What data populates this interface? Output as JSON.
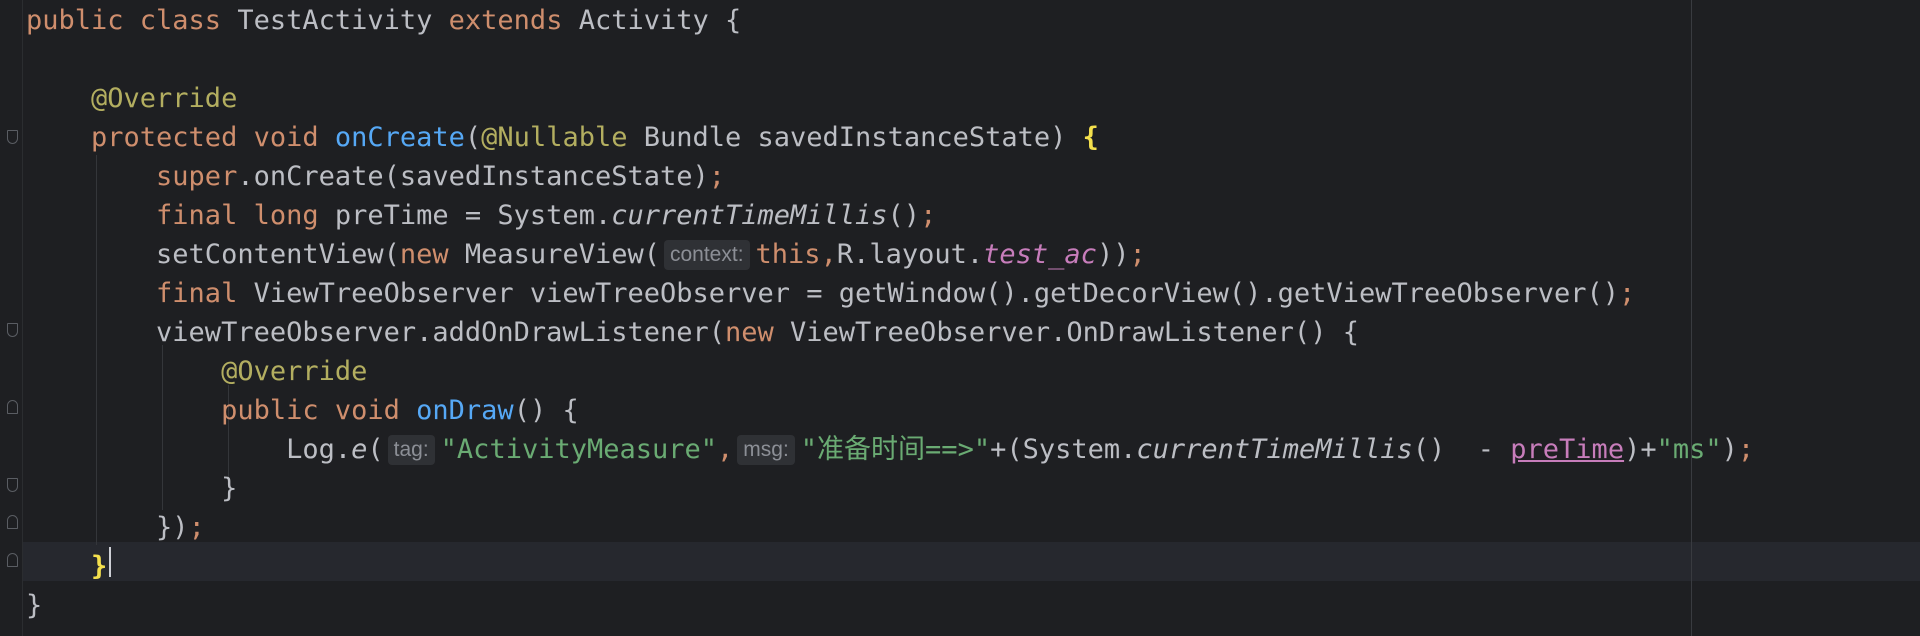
{
  "editor": {
    "lines": [
      {
        "tokens": [
          {
            "t": "public class ",
            "c": "kw"
          },
          {
            "t": "TestActivity ",
            "c": "plain"
          },
          {
            "t": "extends ",
            "c": "kw"
          },
          {
            "t": "Activity {",
            "c": "plain"
          }
        ]
      },
      {
        "tokens": []
      },
      {
        "tokens": [
          {
            "t": "    @Override",
            "c": "ann"
          }
        ]
      },
      {
        "tokens": [
          {
            "t": "    protected void ",
            "c": "kw"
          },
          {
            "t": "onCreate",
            "c": "fn"
          },
          {
            "t": "(",
            "c": "plain"
          },
          {
            "t": "@Nullable ",
            "c": "ann"
          },
          {
            "t": "Bundle savedInstanceState) ",
            "c": "plain"
          },
          {
            "t": "{",
            "c": "brace-hl"
          }
        ]
      },
      {
        "tokens": [
          {
            "t": "        super",
            "c": "kw"
          },
          {
            "t": ".onCreate(savedInstanceState)",
            "c": "plain"
          },
          {
            "t": ";",
            "c": "kw"
          }
        ]
      },
      {
        "tokens": [
          {
            "t": "        final long ",
            "c": "kw"
          },
          {
            "t": "preTime = System.",
            "c": "plain"
          },
          {
            "t": "currentTimeMillis",
            "c": "italic"
          },
          {
            "t": "()",
            "c": "plain"
          },
          {
            "t": ";",
            "c": "kw"
          }
        ]
      },
      {
        "tokens": [
          {
            "t": "        setContentView(",
            "c": "plain"
          },
          {
            "t": "new ",
            "c": "kw"
          },
          {
            "t": "MeasureView(",
            "c": "plain"
          },
          {
            "t": "context:",
            "c": "hint"
          },
          {
            "t": "this",
            "c": "kw"
          },
          {
            "t": ",",
            "c": "kw"
          },
          {
            "t": "R.layout.",
            "c": "plain"
          },
          {
            "t": "test_ac",
            "c": "field"
          },
          {
            "t": "))",
            "c": "plain"
          },
          {
            "t": ";",
            "c": "kw"
          }
        ]
      },
      {
        "tokens": [
          {
            "t": "        final ",
            "c": "kw"
          },
          {
            "t": "ViewTreeObserver viewTreeObserver = getWindow().getDecorView().getViewTreeObserver()",
            "c": "plain"
          },
          {
            "t": ";",
            "c": "kw"
          }
        ]
      },
      {
        "tokens": [
          {
            "t": "        viewTreeObserver.addOnDrawListener(",
            "c": "plain"
          },
          {
            "t": "new ",
            "c": "kw"
          },
          {
            "t": "ViewTreeObserver.OnDrawListener() {",
            "c": "plain"
          }
        ]
      },
      {
        "tokens": [
          {
            "t": "            @Override",
            "c": "ann"
          }
        ]
      },
      {
        "tokens": [
          {
            "t": "            public void ",
            "c": "kw"
          },
          {
            "t": "onDraw",
            "c": "fn"
          },
          {
            "t": "() {",
            "c": "plain"
          }
        ]
      },
      {
        "tokens": [
          {
            "t": "                Log.",
            "c": "plain"
          },
          {
            "t": "e",
            "c": "italic"
          },
          {
            "t": "(",
            "c": "plain"
          },
          {
            "t": "tag:",
            "c": "hint"
          },
          {
            "t": "\"ActivityMeasure\"",
            "c": "str"
          },
          {
            "t": ",",
            "c": "kw"
          },
          {
            "t": "msg:",
            "c": "hint"
          },
          {
            "t": "\"准备时间==>\"",
            "c": "str"
          },
          {
            "t": "+(System.",
            "c": "plain"
          },
          {
            "t": "currentTimeMillis",
            "c": "italic"
          },
          {
            "t": "()  - ",
            "c": "plain"
          },
          {
            "t": "preTime",
            "c": "local"
          },
          {
            "t": ")+",
            "c": "plain"
          },
          {
            "t": "\"ms\"",
            "c": "str"
          },
          {
            "t": ")",
            "c": "plain"
          },
          {
            "t": ";",
            "c": "kw"
          }
        ]
      },
      {
        "tokens": [
          {
            "t": "            }",
            "c": "plain"
          }
        ]
      },
      {
        "tokens": [
          {
            "t": "        })",
            "c": "plain"
          },
          {
            "t": ";",
            "c": "kw"
          }
        ]
      },
      {
        "tokens": [
          {
            "t": "    ",
            "c": "plain"
          },
          {
            "t": "}",
            "c": "brace-hl"
          }
        ]
      },
      {
        "tokens": [
          {
            "t": "}",
            "c": "plain"
          }
        ]
      }
    ]
  }
}
